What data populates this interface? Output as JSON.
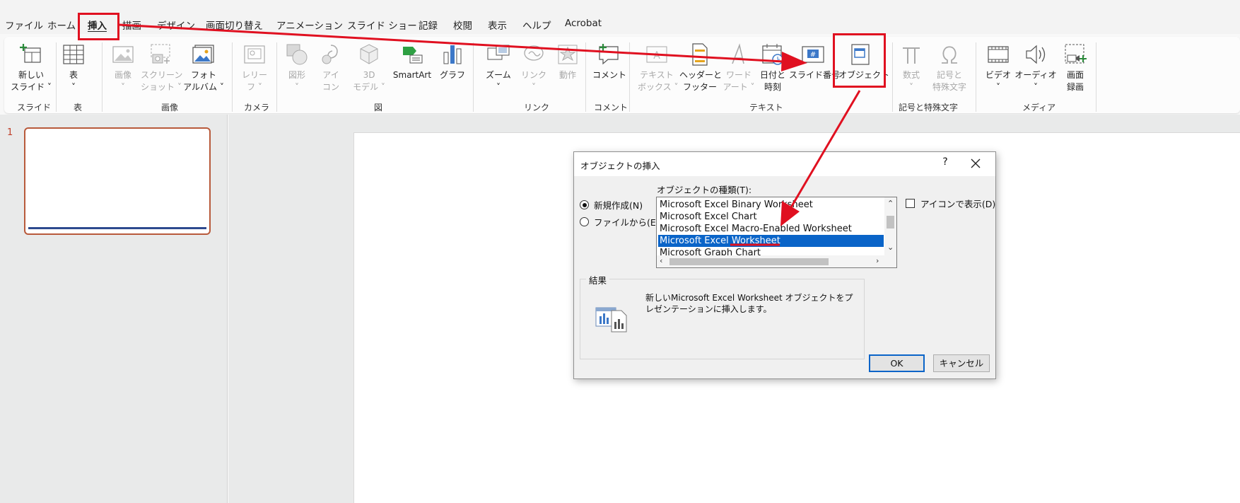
{
  "menu": {
    "tabs": [
      {
        "label": "ファイル"
      },
      {
        "label": "ホーム"
      },
      {
        "label": "挿入"
      },
      {
        "label": "描画"
      },
      {
        "label": "デザイン"
      },
      {
        "label": "画面切り替え"
      },
      {
        "label": "アニメーション"
      },
      {
        "label": "スライド ショー"
      },
      {
        "label": "記録"
      },
      {
        "label": "校閲"
      },
      {
        "label": "表示"
      },
      {
        "label": "ヘルプ"
      },
      {
        "label": "Acrobat"
      }
    ],
    "active_tab": "挿入"
  },
  "ribbon": {
    "buttons": {
      "new_slide": {
        "line1": "新しい",
        "line2": "スライド ˅"
      },
      "table": {
        "line1": "表",
        "line2": "˅"
      },
      "image": {
        "line1": "画像",
        "line2": "˅"
      },
      "screenshot": {
        "line1": "スクリーン",
        "line2": "ショット ˅"
      },
      "photo_album": {
        "line1": "フォト",
        "line2": "アルバム ˅"
      },
      "camera": {
        "line1": "レリー",
        "line2": "フ ˅"
      },
      "shapes": {
        "line1": "図形",
        "line2": "˅"
      },
      "icons": {
        "line1": "アイ",
        "line2": "コン"
      },
      "models3d": {
        "line1": "3D",
        "line2": "モデル ˅"
      },
      "smartart": {
        "line1": "SmartArt",
        "line2": ""
      },
      "chart": {
        "line1": "グラフ",
        "line2": ""
      },
      "zoom": {
        "line1": "ズーム",
        "line2": "˅"
      },
      "link": {
        "line1": "リンク",
        "line2": "˅"
      },
      "action": {
        "line1": "動作",
        "line2": ""
      },
      "comment": {
        "line1": "コメント",
        "line2": ""
      },
      "textbox": {
        "line1": "テキスト",
        "line2": "ボックス ˅"
      },
      "header_footer": {
        "line1": "ヘッダーと",
        "line2": "フッター"
      },
      "wordart": {
        "line1": "ワード",
        "line2": "アート ˅"
      },
      "date_time": {
        "line1": "日付と",
        "line2": "時刻"
      },
      "slide_number": {
        "line1": "スライド番号",
        "line2": ""
      },
      "object": {
        "line1": "オブジェクト",
        "line2": ""
      },
      "equation": {
        "line1": "数式",
        "line2": "˅"
      },
      "symbol": {
        "line1": "記号と",
        "line2": "特殊文字"
      },
      "video": {
        "line1": "ビデオ",
        "line2": "˅"
      },
      "audio": {
        "line1": "オーディオ",
        "line2": "˅"
      },
      "screen_record": {
        "line1": "画面",
        "line2": "録画"
      }
    },
    "groups": {
      "slides": "スライド",
      "table": "表",
      "images": "画像",
      "camera": "カメラ",
      "illustrations": "図",
      "links": "リンク",
      "comments": "コメント",
      "text": "テキスト",
      "symbols": "記号と特殊文字",
      "media": "メディア"
    }
  },
  "slides_pane": {
    "slide_number": "1"
  },
  "dialog": {
    "title": "オブジェクトの挿入",
    "help": "?",
    "radio_new": "新規作成(N)",
    "radio_file": "ファイルから(E)",
    "type_label": "オブジェクトの種類(T):",
    "list_items": [
      "Microsoft Excel Binary Worksheet",
      "Microsoft Excel Chart",
      "Microsoft Excel Macro-Enabled Worksheet",
      "Microsoft Excel Worksheet",
      "Microsoft Graph Chart"
    ],
    "selected_item": "Microsoft Excel Worksheet",
    "display_as_icon": "アイコンで表示(D)",
    "result_label": "結果",
    "result_text": "新しいMicrosoft Excel Worksheet オブジェクトをプレゼンテーションに挿入します。",
    "ok": "OK",
    "cancel": "キャンセル"
  },
  "colors": {
    "highlight": "#e01020",
    "selection": "#0a64c8",
    "slide_border": "#b85a3b"
  }
}
